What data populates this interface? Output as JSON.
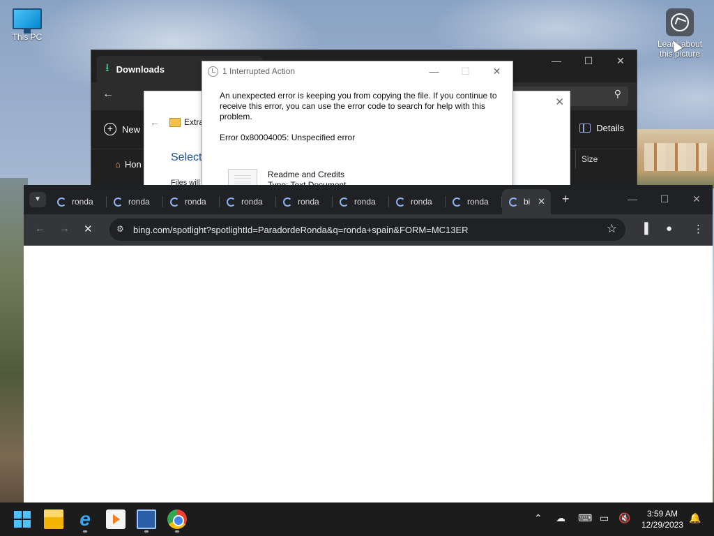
{
  "desktop": {
    "this_pc_label": "This PC",
    "learn_label_line1": "Learn about",
    "learn_label_line2": "this picture"
  },
  "explorer": {
    "tab_title": "Downloads",
    "new_label": "New",
    "details_label": "Details",
    "side_item_home": "Hon",
    "column_size": "Size"
  },
  "extract": {
    "zip_label": "Extra",
    "heading": "Select",
    "files_text": "Files will"
  },
  "interrupted": {
    "title": "1 Interrupted Action",
    "message": "An unexpected error is keeping you from copying the file. If you continue to receive this error, you can use the error code to search for help with this problem.",
    "error_code": "Error 0x80004005: Unspecified error",
    "file_name": "Readme and Credits",
    "file_type": "Type: Text Document"
  },
  "chrome": {
    "tabs": [
      {
        "label": "ronda"
      },
      {
        "label": "ronda"
      },
      {
        "label": "ronda"
      },
      {
        "label": "ronda"
      },
      {
        "label": "ronda"
      },
      {
        "label": "ronda"
      },
      {
        "label": "ronda"
      },
      {
        "label": "ronda"
      },
      {
        "label": "bi"
      }
    ],
    "url": "bing.com/spotlight?spotlightId=ParadordeRonda&q=ronda+spain&FORM=MC13ER"
  },
  "taskbar": {
    "time": "3:59 AM",
    "date": "12/29/2023"
  },
  "colors": {
    "accent": "#8ab4f8",
    "downloads_icon": "#3dd68c",
    "start": "#4cc2ff"
  }
}
